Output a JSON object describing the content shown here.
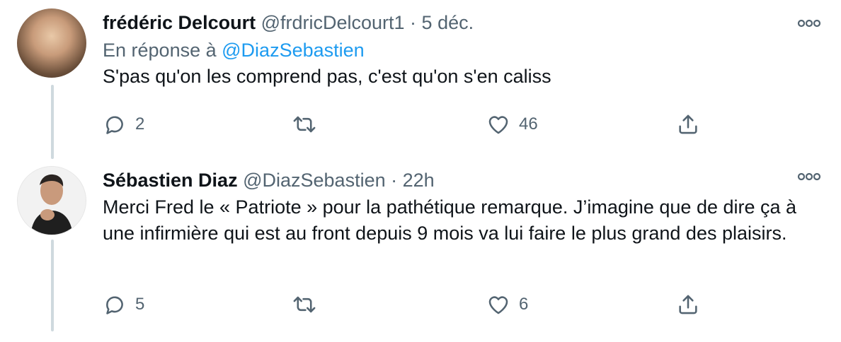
{
  "tweets": [
    {
      "author_name": "frédéric Delcourt",
      "handle_time": "@frdricDelcourt1 · 5 déc.",
      "reply_prefix": "En réponse à",
      "reply_mention": "@DiazSebastien",
      "text": "S'pas qu'on les comprend pas, c'est qu'on s'en caliss",
      "replies": "2",
      "likes": "46"
    },
    {
      "author_name": "Sébastien Diaz",
      "handle_time": "@DiazSebastien · 22h",
      "text": "Merci Fred le « Patriote » pour la pathétique remarque. J’imagine que de dire ça à une infirmière qui est au front depuis 9 mois va lui faire le plus grand des plaisirs.",
      "replies": "5",
      "likes": "6"
    }
  ],
  "icons": [
    "more-icon",
    "reply-icon",
    "retweet-icon",
    "like-icon",
    "share-icon"
  ],
  "colors": {
    "text": "#0f1419",
    "secondary": "#536471",
    "link": "#1d9bf0",
    "thread_line": "#cfd9de"
  }
}
